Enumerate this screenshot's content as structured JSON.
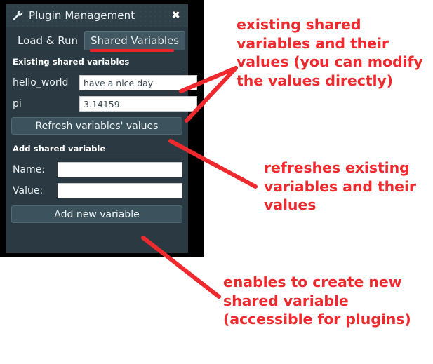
{
  "window": {
    "title": "Plugin Management",
    "wrench_icon": "wrench-icon",
    "close_label": "✖"
  },
  "tabs": [
    {
      "label": "Load & Run",
      "active": false
    },
    {
      "label": "Shared Variables",
      "active": true
    }
  ],
  "existing_section": {
    "heading": "Existing shared variables",
    "variables": [
      {
        "name": "hello_world",
        "value": "have a nice day"
      },
      {
        "name": "pi",
        "value": "3.14159"
      }
    ],
    "refresh_button": "Refresh variables' values"
  },
  "add_section": {
    "heading": "Add shared variable",
    "name_label": "Name:",
    "name_value": "",
    "value_label": "Value:",
    "value_value": "",
    "add_button": "Add new variable"
  },
  "annotations": {
    "existing": "existing shared variables and their values (you can modify the values directly)",
    "refresh": "refreshes existing variables and their values",
    "add": "enables to create new shared variable (accessible for plugins)"
  },
  "colors": {
    "annotation_red": "#ef2a2f",
    "panel_background": "#2b3a42",
    "title_bar": "#2f4049",
    "button": "#3c525c",
    "active_tab": "#415761"
  }
}
